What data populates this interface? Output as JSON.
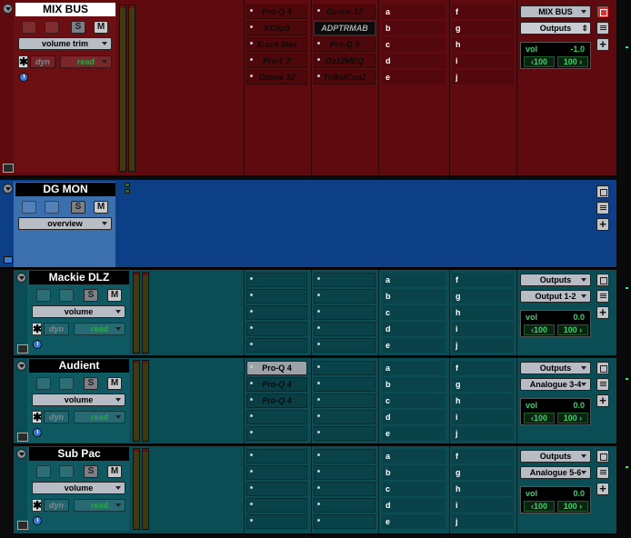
{
  "colors": {
    "mix_bus": "#5e0a0e",
    "dg_mon": "#0d3f86",
    "teal": "#0b4d54",
    "vol_green": "#39d46b"
  },
  "tracks": {
    "mix_bus": {
      "name": "MIX BUS",
      "solo": "S",
      "mute": "M",
      "auto_mode": "volume trim",
      "dyn": "dyn",
      "read": "read",
      "inserts_a": [
        "Pro-Q 4",
        "KClip3",
        "Xrack Max",
        "Pro-L 2",
        "Ozone 12"
      ],
      "inserts_b": [
        "Ozone 12",
        "ADPTRMAB",
        "Pro-Q 4",
        "Oz12MEQ",
        "ToBalCon2"
      ],
      "sends_a": [
        "a",
        "b",
        "c",
        "d",
        "e"
      ],
      "sends_b": [
        "f",
        "g",
        "h",
        "i",
        "j"
      ],
      "input": "MIX BUS",
      "output": "Outputs",
      "vol_label": "vol",
      "vol_value": "-1.0",
      "pan_l": "‹100",
      "pan_r": "100 ›"
    },
    "dg_mon": {
      "name": "DG MON",
      "solo": "S",
      "mute": "M",
      "auto_mode": "overview"
    },
    "mackie": {
      "name": "Mackie DLZ",
      "solo": "S",
      "mute": "M",
      "auto_mode": "volume",
      "dyn": "dyn",
      "read": "read",
      "sends_a": [
        "a",
        "b",
        "c",
        "d",
        "e"
      ],
      "sends_b": [
        "f",
        "g",
        "h",
        "i",
        "j"
      ],
      "input": "Outputs",
      "output": "Output 1-2",
      "vol_label": "vol",
      "vol_value": "0.0",
      "pan_l": "‹100",
      "pan_r": "100 ›"
    },
    "audient": {
      "name": "Audient",
      "solo": "S",
      "mute": "M",
      "auto_mode": "volume",
      "dyn": "dyn",
      "read": "read",
      "inserts_a": [
        "Pro-Q 4",
        "Pro-Q 4",
        "Pro-Q 4"
      ],
      "sends_a": [
        "a",
        "b",
        "c",
        "d",
        "e"
      ],
      "sends_b": [
        "f",
        "g",
        "h",
        "i",
        "j"
      ],
      "input": "Outputs",
      "output": "Analogue 3-4",
      "vol_label": "vol",
      "vol_value": "0.0",
      "pan_l": "‹100",
      "pan_r": "100 ›"
    },
    "sub_pac": {
      "name": "Sub Pac",
      "solo": "S",
      "mute": "M",
      "auto_mode": "volume",
      "dyn": "dyn",
      "read": "read",
      "sends_a": [
        "a",
        "b",
        "c",
        "d",
        "e"
      ],
      "sends_b": [
        "f",
        "g",
        "h",
        "i",
        "j"
      ],
      "input": "Outputs",
      "output": "Analogue 5-6",
      "vol_label": "vol",
      "vol_value": "0.0",
      "pan_l": "‹100",
      "pan_r": "100 ›"
    }
  },
  "icons": {
    "asterisk": "✱",
    "plus": "+"
  }
}
